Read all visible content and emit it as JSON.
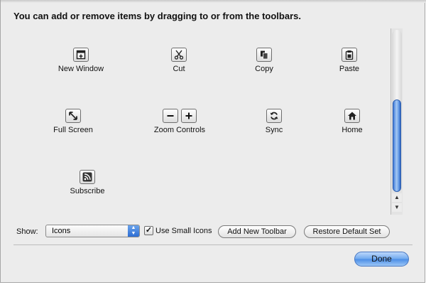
{
  "sheet": {
    "heading": "You can add or remove items by dragging to or from the toolbars."
  },
  "toolbar_items": [
    {
      "label": "New Window",
      "icon": "new-window-icon"
    },
    {
      "label": "Cut",
      "icon": "scissors-icon"
    },
    {
      "label": "Copy",
      "icon": "copy-icon"
    },
    {
      "label": "Paste",
      "icon": "clipboard-icon"
    },
    {
      "label": "Full Screen",
      "icon": "expand-arrows-icon"
    },
    {
      "label": "Zoom Controls",
      "icon": "zoom-controls-icon"
    },
    {
      "label": "Sync",
      "icon": "sync-icon"
    },
    {
      "label": "Home",
      "icon": "home-icon"
    },
    {
      "label": "Subscribe",
      "icon": "rss-icon"
    }
  ],
  "zoom_controls": {
    "minus": "−",
    "plus": "+"
  },
  "scrollbar": {
    "up": "▲",
    "down": "▼"
  },
  "footer": {
    "show_label": "Show:",
    "show_value": "Icons",
    "small_icons_label": "Use Small Icons",
    "small_icons_checked": true,
    "check_mark": "✓",
    "add_toolbar_label": "Add New Toolbar",
    "restore_label": "Restore Default Set",
    "done_label": "Done"
  },
  "colors": {
    "sheet_bg": "#ececec",
    "accent_blue": "#4a8de6"
  }
}
